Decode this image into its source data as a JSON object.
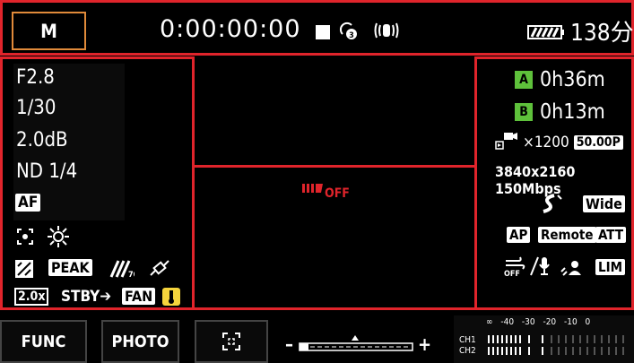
{
  "mode": "M",
  "timecode": "0:00:00:00",
  "battery": "138分",
  "left": {
    "aperture": "F2.8",
    "shutter": "1/30",
    "gain": "2.0dB",
    "nd": "ND 1/4",
    "af": "AF",
    "peak": "PEAK",
    "zoom_mag": "2.0x",
    "stby": "STBY",
    "fan": "FAN"
  },
  "right": {
    "card_a": "A",
    "card_a_time": "0h36m",
    "card_b": "B",
    "card_b_time": "0h13m",
    "slow_x": "×1200",
    "framerate": "50.00P",
    "resolution": "3840x2160 150Mbps",
    "wide": "Wide",
    "ap": "AP",
    "remote": "Remote",
    "att": "ATT",
    "off": "OFF",
    "lim": "LIM"
  },
  "center": {
    "off_label": "OFF"
  },
  "bottom": {
    "func": "FUNC",
    "photo": "PHOTO",
    "minus": "–",
    "plus": "+",
    "meter_scale": "∞ -40 -30 -20 -10 0",
    "ch1": "CH1",
    "ch2": "CH2"
  }
}
